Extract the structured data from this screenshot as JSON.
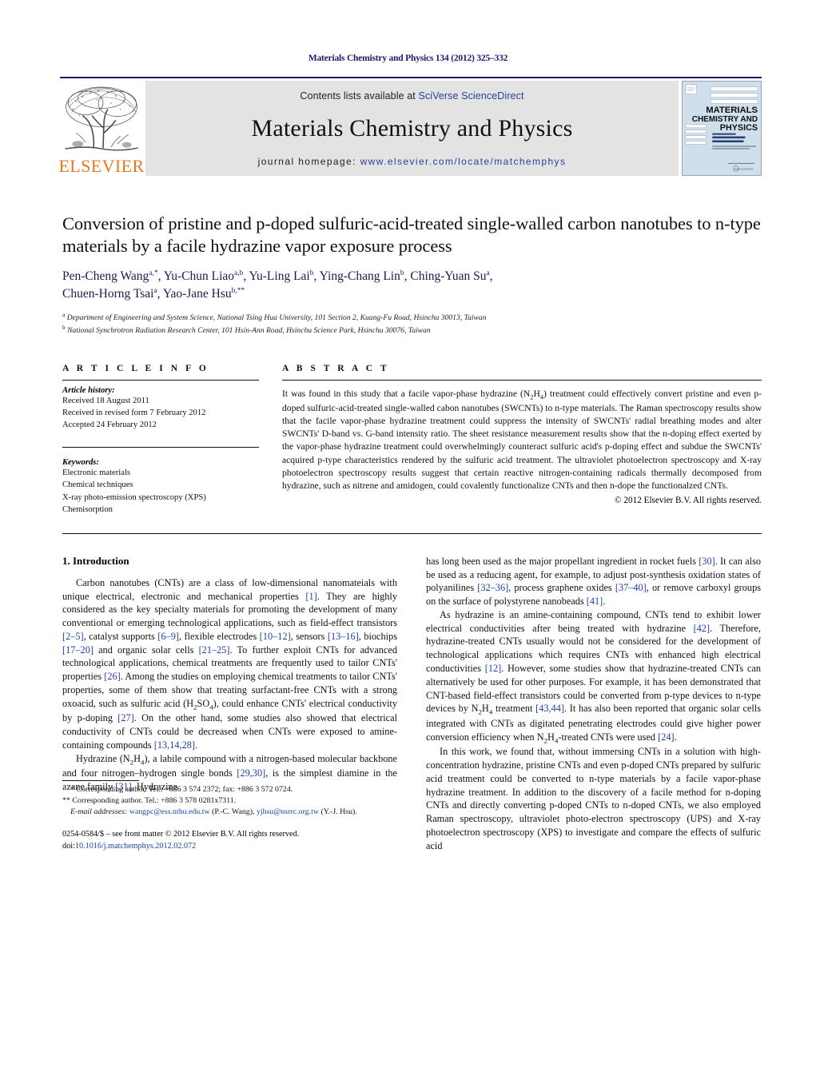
{
  "running_head": "Materials Chemistry and Physics 134 (2012) 325–332",
  "masthead": {
    "publisher_wordmark": "ELSEVIER",
    "contents_prefix": "Contents lists available at ",
    "contents_link": "SciVerse ScienceDirect",
    "journal_title": "Materials Chemistry and Physics",
    "homepage_prefix": "journal homepage: ",
    "homepage_link": "www.elsevier.com/locate/matchemphys",
    "cover_line1": "MATERIALS",
    "cover_line2": "CHEMISTRY AND",
    "cover_line3": "PHYSICS"
  },
  "article": {
    "title": "Conversion of pristine and p-doped sulfuric-acid-treated single-walled carbon nanotubes to n-type materials by a facile hydrazine vapor exposure process",
    "authors_line1": "Pen-Cheng Wang",
    "authors": "Pen-Cheng Wang a,*, Yu-Chun Liao a,b, Yu-Ling Lai b, Ying-Chang Lin b, Ching-Yuan Su a, Chuen-Horng Tsai a, Yao-Jane Hsu b,**",
    "affiliation_a": "Department of Engineering and System Science, National Tsing Hua University, 101 Section 2, Kuang-Fu Road, Hsinchu 30013, Taiwan",
    "affiliation_b": "National Synchrotron Radiation Research Center, 101 Hsin-Ann Road, Hsinchu Science Park, Hsinchu 30076, Taiwan"
  },
  "info": {
    "heading": "A R T I C L E    I N F O",
    "history_label": "Article history:",
    "history": [
      "Received 18 August 2011",
      "Received in revised form 7 February 2012",
      "Accepted 24 February 2012"
    ],
    "keywords_label": "Keywords:",
    "keywords": [
      "Electronic materials",
      "Chemical techniques",
      "X-ray photo-emission spectroscopy (XPS)",
      "Chemisorption"
    ]
  },
  "abstract": {
    "heading": "A B S T R A C T",
    "text": "It was found in this study that a facile vapor-phase hydrazine (N2H4) treatment could effectively convert pristine and even p-doped sulfuric-acid-treated single-walled cabon nanotubes (SWCNTs) to n-type materials. The Raman spectroscopy results show that the facile vapor-phase hydrazine treatment could suppress the intensity of SWCNTs' radial breathing modes and alter SWCNTs' D-band vs. G-band intensity ratio. The sheet resistance measurement results show that the n-doping effect exerted by the vapor-phase hydrazine treatment could overwhelmingly counteract sulfuric acid's p-doping effect and subdue the SWCNTs' acquired p-type characteristics rendered by the sulfuric acid treatment. The ultraviolet photoelectron spectroscopy and X-ray photoelectron spectroscopy results suggest that certain reactive nitrogen-containing radicals thermally decomposed from hydrazine, such as nitrene and amidogen, could covalently functionalize CNTs and then n-dope the functionalzed CNTs.",
    "copyright": "© 2012 Elsevier B.V. All rights reserved."
  },
  "intro": {
    "heading": "1.  Introduction",
    "p1_a": "Carbon nanotubes (CNTs) are a class of low-dimensional nanomateials with unique electrical, electronic and mechanical properties ",
    "p1_r1": "[1]",
    "p1_b": ". They are highly considered as the key specialty materials for promoting the development of many conventional or emerging technological applications, such as field-effect transistors ",
    "p1_r2": "[2–5]",
    "p1_c": ", catalyst supports ",
    "p1_r3": "[6–9]",
    "p1_d": ", flexible electrodes ",
    "p1_r4": "[10–12]",
    "p1_e": ", sensors ",
    "p1_r5": "[13–16]",
    "p1_f": ", biochips ",
    "p1_r6": "[17–20]",
    "p1_g": " and organic solar cells ",
    "p1_r7": "[21–25]",
    "p1_h": ". To further exploit CNTs for advanced technological applications, chemical treatments are frequently used to tailor CNTs' properties ",
    "p1_r8": "[26]",
    "p1_i": ". Among the studies on employing chemical treatments to tailor CNTs' properties, some of them show that treating surfactant-free CNTs with a strong oxoacid, such as sulfuric acid (H2SO4), could enhance CNTs' electrical conductivity by p-doping ",
    "p1_r9": "[27]",
    "p1_j": ". On the other hand, some studies also showed that electrical conductivity of CNTs could be decreased when CNTs were exposed to amine-containing compounds ",
    "p1_r10": "[13,14,28]",
    "p1_k": ".",
    "p2_a": "Hydrazine (N2H4), a labile compound with a nitrogen-based molecular backbone and four nitrogen–hydrogen single bonds ",
    "p2_r1": "[29,30]",
    "p2_b": ", is the simplest diamine in the azane family ",
    "p2_r2": "[31]",
    "p2_c": ". Hydrazine ",
    "p2_d": "has long been used as the major propellant ingredient in rocket fuels ",
    "p2_r3": "[30]",
    "p2_e": ". It can also be used as a reducing agent, for example, to adjust post-synthesis oxidation states of polyanilines ",
    "p2_r4": "[32–36]",
    "p2_f": ", process graphene oxides ",
    "p2_r5": "[37–40]",
    "p2_g": ", or remove carboxyl groups on the surface of polystyrene nanobeads ",
    "p2_r6": "[41]",
    "p2_h": ".",
    "p3_a": "As hydrazine is an amine-containing compound, CNTs tend to exhibit lower electrical conductivities after being treated with hydrazine ",
    "p3_r1": "[42]",
    "p3_b": ". Therefore, hydrazine-treated CNTs usually would not be considered for the development of technological applications which requires CNTs with enhanced high electrical conductivities ",
    "p3_r2": "[12]",
    "p3_c": ". However, some studies show that hydrazine-treated CNTs can alternatively be used for other purposes. For example, it has been demonstrated that CNT-based field-effect transistors could be converted from p-type devices to n-type devices by N2H4 treatment ",
    "p3_r3": "[43,44]",
    "p3_d": ". It has also been reported that organic solar cells integrated with CNTs as digitated penetrating electrodes could give higher power conversion efficiency when N2H4-treated CNTs were used ",
    "p3_r4": "[24]",
    "p3_e": ".",
    "p4": "In this work, we found that, without immersing CNTs in a solution with high-concentration hydrazine, pristine CNTs and even p-doped CNTs prepared by sulfuric acid treatment could be converted to n-type materials by a facile vapor-phase hydrazine treatment. In addition to the discovery of a facile method for n-doping CNTs and directly converting p-doped CNTs to n-doped CNTs, we also employed Raman spectroscopy, ultraviolet photo-electron spectroscopy (UPS) and X-ray photoelectron spectroscopy (XPS) to investigate and compare the effects of sulfuric acid"
  },
  "footnotes": {
    "corr1": "* Corresponding author. Tel.: +886 3 574 2372; fax: +886 3 572 0724.",
    "corr2": "** Corresponding author. Tel.: +886 3 578 0281x7311.",
    "email_label": "E-mail addresses:",
    "email1": "wangpc@ess.nthu.edu.tw",
    "email1_who": "(P.-C. Wang)",
    "email2": "yjhsu@nsrrc.org.tw",
    "email2_who": "(Y.-J. Hsu).",
    "issn_line": "0254-0584/$ – see front matter © 2012 Elsevier B.V. All rights reserved.",
    "doi_label": "doi:",
    "doi_value": "10.1016/j.matchemphys.2012.02.072"
  }
}
